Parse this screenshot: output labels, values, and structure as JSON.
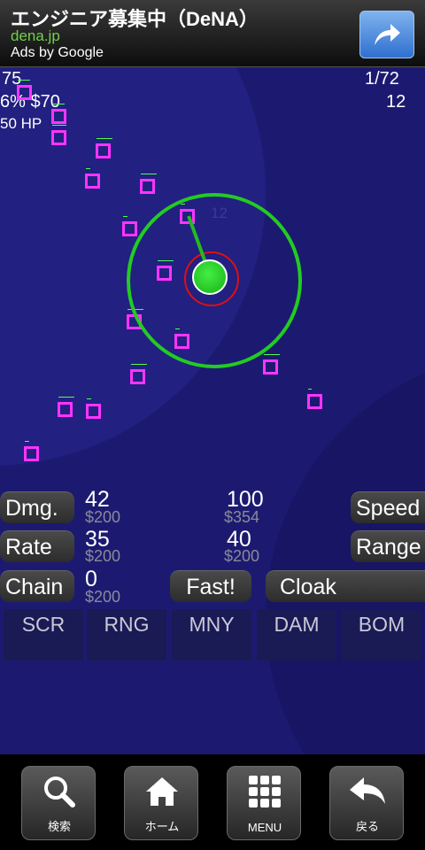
{
  "ad": {
    "headline": "エンジニア募集中（DeNA）",
    "url": "dena.jp",
    "ads_by": "Ads by Google",
    "share_icon": "share-arrow-icon"
  },
  "hud": {
    "lives": "75",
    "percent_money": "6% $70",
    "hp": "50 HP",
    "wave": "1/72",
    "enemies_left": "12"
  },
  "tower_label": "12",
  "upgrades": [
    {
      "label": "Dmg.",
      "value": "42",
      "cost": "$200"
    },
    {
      "label": "Rate",
      "value": "35",
      "cost": "$200"
    },
    {
      "label": "Chain",
      "value": "0",
      "cost": "$200"
    }
  ],
  "upgrades_right": [
    {
      "label": "Speed",
      "value": "100",
      "cost": "$354"
    },
    {
      "label": "Range",
      "value": "40",
      "cost": "$200"
    }
  ],
  "buttons": {
    "fast": "Fast!",
    "cloak": "Cloak"
  },
  "tabs": [
    "SCR",
    "RNG",
    "MNY",
    "DAM",
    "BOM"
  ],
  "nav": [
    {
      "label": "検索",
      "icon": "search-icon"
    },
    {
      "label": "ホーム",
      "icon": "home-icon"
    },
    {
      "label": "MENU",
      "icon": "menu-grid-icon"
    },
    {
      "label": "戻る",
      "icon": "back-arrow-icon"
    }
  ],
  "colors": {
    "enemy": "#ff33ff",
    "tower": "#22cc22",
    "background": "#1c1a70"
  }
}
